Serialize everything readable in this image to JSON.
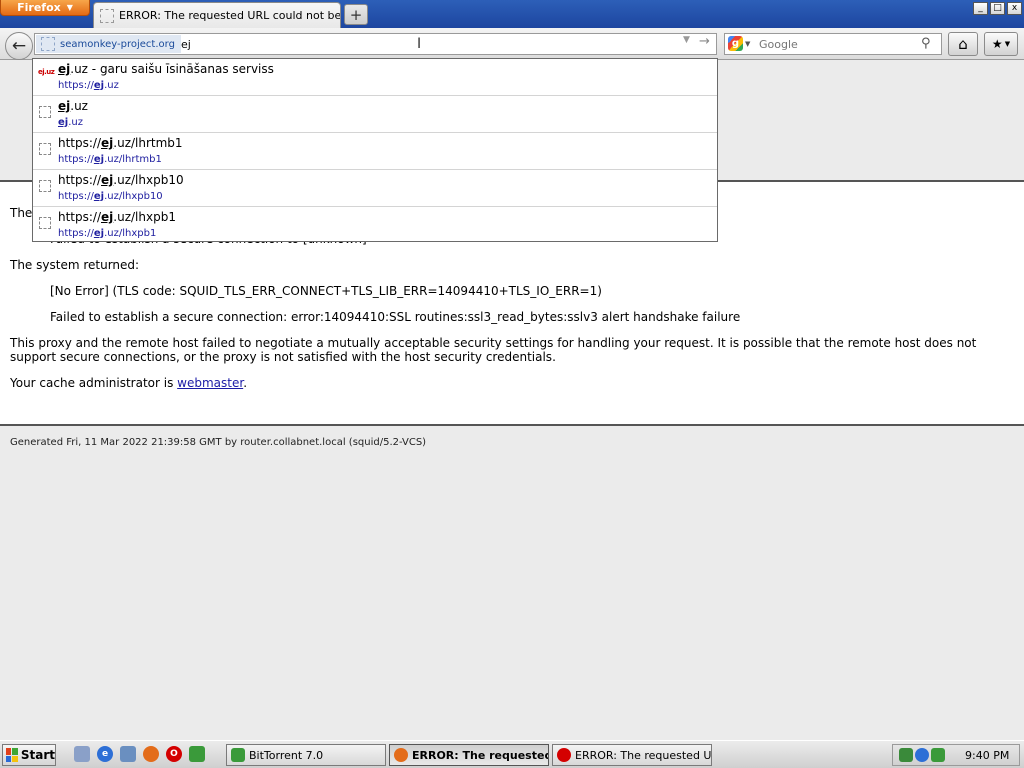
{
  "browser": {
    "app_menu_label": "Firefox",
    "active_tab_title": "ERROR: The requested URL could not be ret...",
    "new_tab_symbol": "+",
    "window_controls": {
      "minimize": "_",
      "maximize": "□",
      "close": "x"
    },
    "back_symbol": "←",
    "identity_label": "seamonkey-project.org",
    "url_value": "ej",
    "search_placeholder": "Google",
    "search_engine_letter": "g",
    "home_symbol": "⌂",
    "bookmarks_symbol": "★"
  },
  "autocomplete": {
    "items": [
      {
        "title_pre": "",
        "title_match": "ej",
        "title_post": ".uz - garu saišu īsināšanas serviss",
        "url_pre": "https://",
        "url_match": "ej",
        "url_post": ".uz",
        "favicon": "ej-logo-icon",
        "favicon_text": "ej.uz"
      },
      {
        "title_pre": "",
        "title_match": "ej",
        "title_post": ".uz",
        "url_pre": "",
        "url_match": "ej",
        "url_post": ".uz",
        "favicon": "blank-page-icon"
      },
      {
        "title_pre": "https://",
        "title_match": "ej",
        "title_post": ".uz/lhrtmb1",
        "url_pre": "https://",
        "url_match": "ej",
        "url_post": ".uz/lhrtmb1",
        "favicon": "blank-page-icon"
      },
      {
        "title_pre": "https://",
        "title_match": "ej",
        "title_post": ".uz/lhxpb10",
        "url_pre": "https://",
        "url_match": "ej",
        "url_post": ".uz/lhxpb10",
        "favicon": "blank-page-icon"
      },
      {
        "title_pre": "https://",
        "title_match": "ej",
        "title_post": ".uz/lhxpb1",
        "url_pre": "https://",
        "url_match": "ej",
        "url_post": ".uz/lhxpb1",
        "favicon": "blank-page-icon"
      }
    ]
  },
  "page": {
    "partial_line_1": "The",
    "partial_line_2": "Failed to establish a secure connection to [unknown]",
    "system_returned_label": "The system returned:",
    "error_line_1": "[No Error] (TLS code: SQUID_TLS_ERR_CONNECT+TLS_LIB_ERR=14094410+TLS_IO_ERR=1)",
    "error_line_2": "Failed to establish a secure connection: error:14094410:SSL routines:ssl3_read_bytes:sslv3 alert handshake failure",
    "explanation": "This proxy and the remote host failed to negotiate a mutually acceptable security settings for handling your request. It is possible that the remote host does not support secure connections, or the proxy is not satisfied with the host security credentials.",
    "admin_prefix": "Your cache administrator is ",
    "admin_link": "webmaster",
    "admin_suffix": ".",
    "footer": "Generated Fri, 11 Mar 2022 21:39:58 GMT by router.collabnet.local (squid/5.2-VCS)"
  },
  "taskbar": {
    "start_label": "Start",
    "tasks": [
      {
        "label": "BitTorrent 7.0",
        "icon": "bittorrent-icon",
        "active": false
      },
      {
        "label": "ERROR: The requested...",
        "icon": "firefox-icon",
        "active": true
      },
      {
        "label": "ERROR: The requested U...",
        "icon": "opera-icon",
        "active": false
      }
    ],
    "clock": "9:40 PM"
  },
  "colors": {
    "firefox_orange": "#e46a14",
    "title_blue": "#1d46a0",
    "link_blue": "#1a1aa6",
    "match_url_blue": "#2020a0"
  }
}
